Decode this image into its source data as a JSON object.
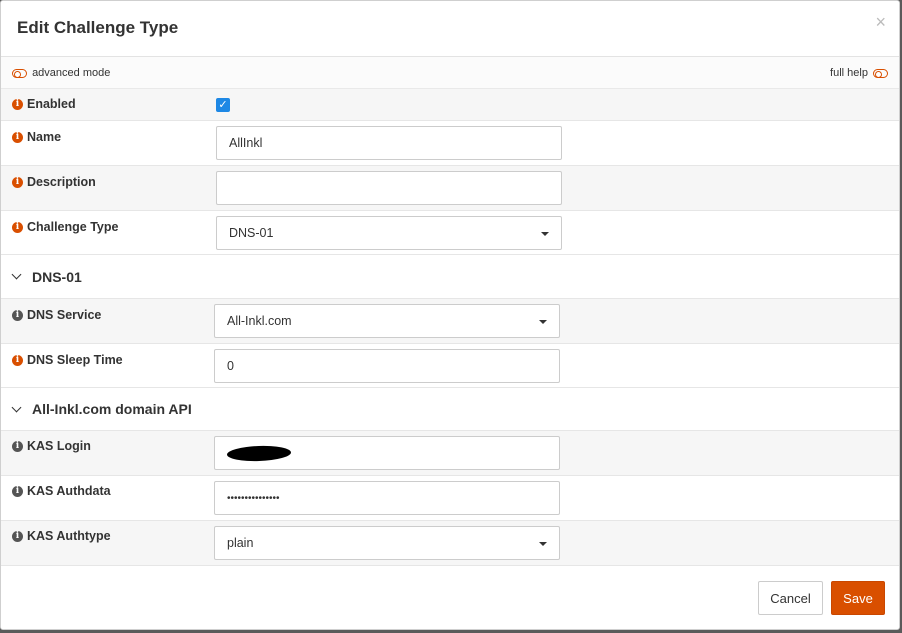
{
  "dialog": {
    "title": "Edit Challenge Type",
    "close_symbol": "×"
  },
  "mode_bar": {
    "advanced_label": "advanced mode",
    "help_label": "full help"
  },
  "fields": {
    "enabled": {
      "label": "Enabled",
      "checked": true,
      "check_symbol": "✓"
    },
    "name": {
      "label": "Name",
      "value": "AllInkl"
    },
    "description": {
      "label": "Description",
      "value": ""
    },
    "challenge_type": {
      "label": "Challenge Type",
      "value": "DNS-01"
    }
  },
  "section_dns": {
    "title": "DNS-01",
    "dns_service": {
      "label": "DNS Service",
      "value": "All-Inkl.com"
    },
    "dns_sleep": {
      "label": "DNS Sleep Time",
      "value": "0"
    }
  },
  "section_api": {
    "title": "All-Inkl.com domain API",
    "kas_login": {
      "label": "KAS Login",
      "value": ""
    },
    "kas_authdata": {
      "label": "KAS Authdata",
      "value": "•••••••••••••••"
    },
    "kas_authtype": {
      "label": "KAS Authtype",
      "value": "plain"
    }
  },
  "buttons": {
    "cancel": "Cancel",
    "save": "Save"
  },
  "colors": {
    "accent": "#d94f00",
    "checkbox": "#1e88e5"
  },
  "icons": {
    "info": "i"
  }
}
